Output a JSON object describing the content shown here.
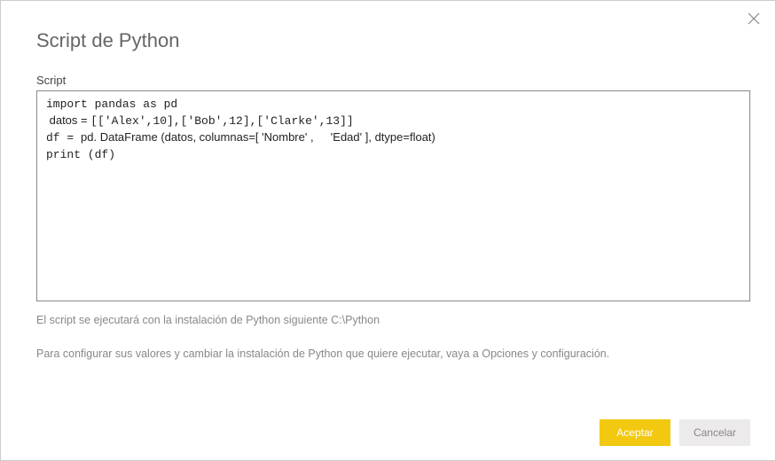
{
  "dialog": {
    "title": "Script de Python",
    "field_label": "Script",
    "script_lines": {
      "l1": "import pandas as pd",
      "l2a": " datos = ",
      "l2b": "[['Alex',10],['Bob',12],['Clarke',13]]",
      "l3a": "df = ",
      "l3b": "pd. DataFrame (datos, columnas=[ 'Nombre' , ",
      "l3c": "'Edad' ], dtype=float)",
      "l4": "print (df)"
    },
    "hint1": "El script se ejecutará con la instalación de Python siguiente C:\\Python",
    "hint2": "Para configurar sus valores y cambiar la instalación de Python que quiere ejecutar, vaya a Opciones y configuración.",
    "ok_label": "Aceptar",
    "cancel_label": "Cancelar"
  }
}
